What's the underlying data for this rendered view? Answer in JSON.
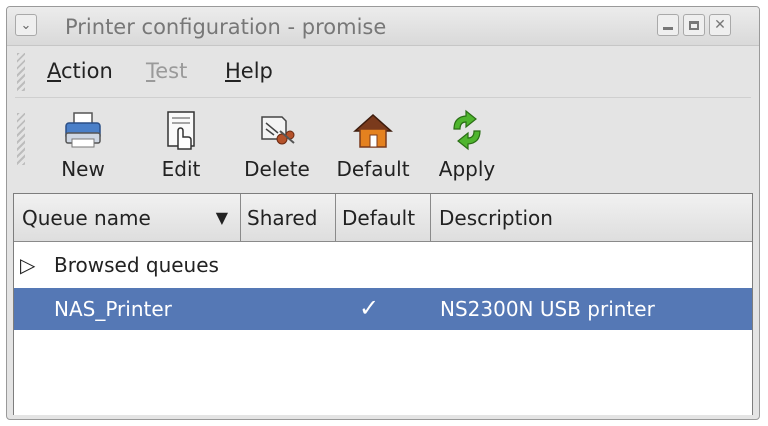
{
  "window": {
    "title": "Printer configuration - promise",
    "menu_icon": "chevron-down-icon",
    "controls": {
      "minimize": "minimize-icon",
      "maximize": "maximize-icon",
      "close": "close-icon"
    }
  },
  "menubar": {
    "items": [
      {
        "mnemonic": "A",
        "rest": "ction",
        "enabled": true
      },
      {
        "mnemonic": "T",
        "rest": "est",
        "enabled": false
      },
      {
        "mnemonic": "H",
        "rest": "elp",
        "enabled": true
      }
    ]
  },
  "toolbar": {
    "buttons": [
      {
        "label": "New",
        "icon": "printer-icon"
      },
      {
        "label": "Edit",
        "icon": "edit-document-icon"
      },
      {
        "label": "Delete",
        "icon": "delete-icon"
      },
      {
        "label": "Default",
        "icon": "home-icon"
      },
      {
        "label": "Apply",
        "icon": "refresh-icon"
      }
    ]
  },
  "table": {
    "columns": [
      "Queue name",
      "Shared",
      "Default",
      "Description"
    ],
    "sort_icon": "chevron-down-icon",
    "rows": [
      {
        "expander": "▷",
        "name": "Browsed queues",
        "shared": "",
        "default": "",
        "description": "",
        "selected": false
      },
      {
        "name": "NAS_Printer",
        "shared": "",
        "default": "✓",
        "description": "NS2300N USB printer",
        "selected": true
      }
    ]
  },
  "colors": {
    "selection": "#5578b5",
    "window_bg": "#e4e4e4",
    "title_text": "#777777"
  }
}
